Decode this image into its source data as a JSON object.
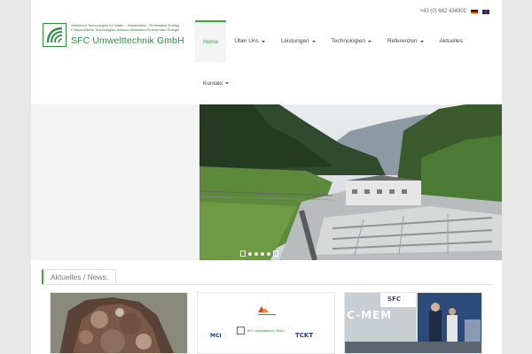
{
  "utility": {
    "phone": "+43 (0) 662 434902"
  },
  "logo": {
    "tagline_1": "Advanced Technologies for Water – Wastewater - Renewable Energy",
    "tagline_2": "Fortschrittliche Technologien Wasser-Abwasser-Erneuerbare Energie",
    "brand": "SFC Umwelttechnik GmbH"
  },
  "nav": {
    "items": [
      {
        "label": "Home"
      },
      {
        "label": "Über Uns"
      },
      {
        "label": "Leistungen"
      },
      {
        "label": "Technologien"
      },
      {
        "label": "Referenzen"
      },
      {
        "label": "Aktuelles"
      }
    ],
    "second_row": {
      "label": "Kontakt"
    }
  },
  "news": {
    "heading": "Aktuelles / News:",
    "card2": {
      "sfc": "SFC Umwelttechnik GmbH",
      "mci": "MCI",
      "tckt": "TCKT"
    },
    "card3": {
      "banner": "C-MEM",
      "sign": "SFC"
    }
  },
  "colors": {
    "accent": "#3fa63f",
    "brand_green": "#2f8f3f"
  }
}
